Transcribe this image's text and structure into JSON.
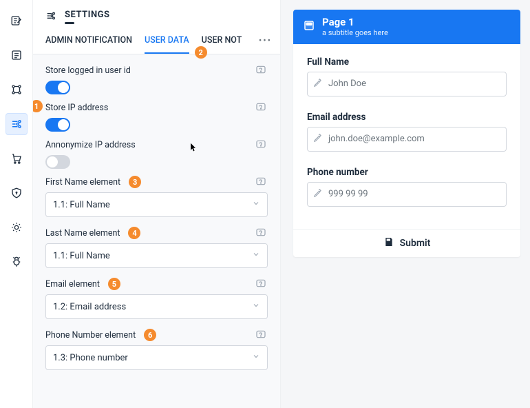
{
  "rail": {
    "activeIndex": 3
  },
  "settings": {
    "title": "SETTINGS",
    "tabs": {
      "t0": "ADMIN NOTIFICATION",
      "t1": "USER DATA",
      "t2": "USER NOTIFICA"
    },
    "storeUserId": {
      "label": "Store logged in user id"
    },
    "storeIp": {
      "label": "Store IP address"
    },
    "anonIp": {
      "label": "Annonymize IP address"
    },
    "firstName": {
      "label": "First Name element",
      "value": "1.1: Full Name"
    },
    "lastName": {
      "label": "Last Name element",
      "value": "1.1: Full Name"
    },
    "email": {
      "label": "Email element",
      "value": "1.2: Email address"
    },
    "phone": {
      "label": "Phone Number element",
      "value": "1.3: Phone number"
    }
  },
  "preview": {
    "title": "Page 1",
    "subtitle": "a subtitle goes here",
    "fullName": {
      "label": "Full Name",
      "placeholder": "John Doe"
    },
    "email": {
      "label": "Email address",
      "placeholder": "john.doe@example.com"
    },
    "phone": {
      "label": "Phone number",
      "placeholder": "999 99 99"
    },
    "submit": "Submit"
  },
  "badges": {
    "b1": "1",
    "b2": "2",
    "b3": "3",
    "b4": "4",
    "b5": "5",
    "b6": "6"
  }
}
